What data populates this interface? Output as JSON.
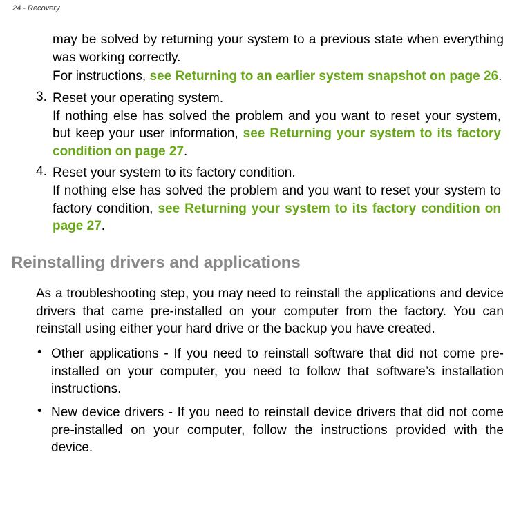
{
  "header": {
    "page_label": "24 - Recovery"
  },
  "intro": {
    "line1_pre": "may be solved by returning your system to a previous state when everything was working correctly.",
    "line2_pre": "For instructions, ",
    "link1": "see Returning to an earlier system snapshot on page 26",
    "line2_post": "."
  },
  "item3": {
    "num": "3.",
    "title": "Reset your operating system.",
    "body_pre": "If nothing else has solved the problem and you want to reset your system, but keep your user information, ",
    "link": "see Returning your system to its factory condition on page 27",
    "body_post": "."
  },
  "item4": {
    "num": "4.",
    "title": "Reset your system to its factory condition.",
    "body_pre": "If nothing else has solved the problem and you want to reset your system to factory condition, ",
    "link": "see Returning your system to its factory condition on page 27",
    "body_post": "."
  },
  "section": {
    "heading": "Reinstalling drivers and applications",
    "para1": "As a troubleshooting step, you may need to reinstall the applications and device drivers that came pre-installed on your computer from the factory. You can reinstall using either your hard drive or the backup you have created.",
    "bullet1": "Other applications - If you need to reinstall software that did not come pre-installed on your computer, you need to follow that software’s installation instructions.",
    "bullet2": "New device drivers - If you need to reinstall device drivers that did not come pre-installed on your computer, follow the instructions provided with the device."
  }
}
